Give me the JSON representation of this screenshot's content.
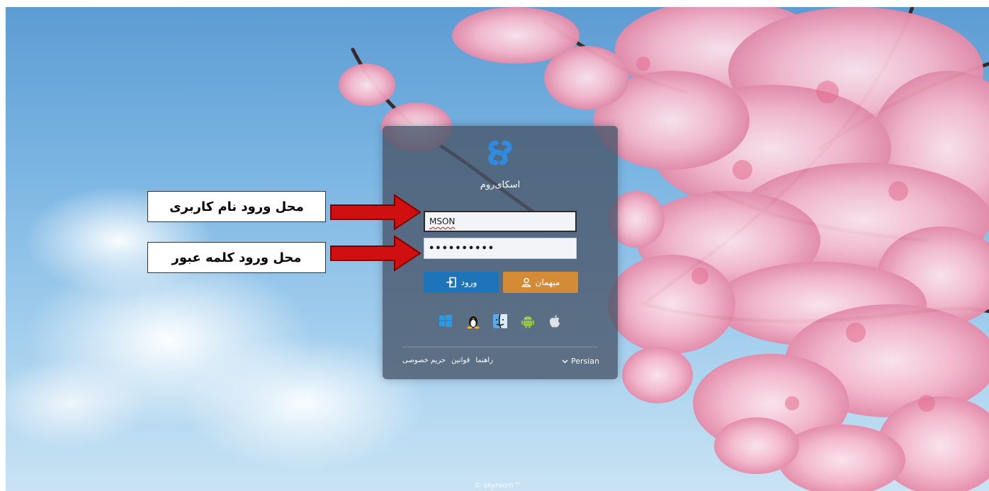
{
  "app": {
    "name": "اسکای‌روم"
  },
  "form": {
    "username_value": "MSON",
    "password_value": "••••••••••"
  },
  "buttons": {
    "guest_label": "میهمان",
    "login_label": "ورود"
  },
  "platforms": [
    "windows-icon",
    "linux-icon",
    "mac-finder-icon",
    "android-icon",
    "apple-icon"
  ],
  "footer": {
    "language": "Persian",
    "links": [
      "راهنما",
      "قوانین",
      "حریم خصوصی"
    ],
    "copyright": "© skyroom™"
  },
  "annotations": {
    "username_note": "محل ورود نام کاربری",
    "password_note": "محل ورود کلمه عبور"
  },
  "colors": {
    "guest_button": "#d58a36",
    "login_button": "#1e74b8",
    "arrow": "#d01010",
    "logo": "#2f8be0"
  }
}
